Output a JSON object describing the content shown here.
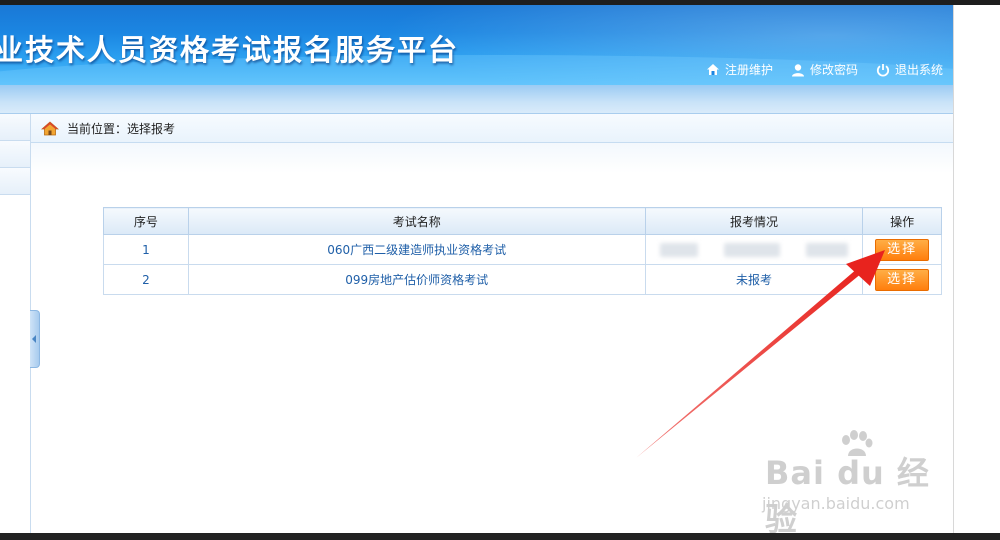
{
  "header": {
    "title": "业技术人员资格考试报名服务平台",
    "links": [
      {
        "label": "注册维护",
        "icon": "home-icon"
      },
      {
        "label": "修改密码",
        "icon": "user-icon"
      },
      {
        "label": "退出系统",
        "icon": "power-icon"
      }
    ]
  },
  "breadcrumb": {
    "text": "当前位置：选择报考",
    "icon": "home-icon"
  },
  "table": {
    "headers": [
      "序号",
      "考试名称",
      "报考情况",
      "操作"
    ],
    "rows": [
      {
        "index": "1",
        "name": "060广西二级建造师执业资格考试",
        "status": "",
        "action": "选择"
      },
      {
        "index": "2",
        "name": "099房地产估价师资格考试",
        "status": "未报考",
        "action": "选择"
      }
    ]
  },
  "colors": {
    "header_blue": "#1b86e2",
    "button_orange": "#ff8a1f",
    "link_blue": "#1f5fa8",
    "annotation_red": "#e8231e"
  },
  "watermark": {
    "logo": "Bai du 经验",
    "sub": "jingyan.baidu.com"
  }
}
